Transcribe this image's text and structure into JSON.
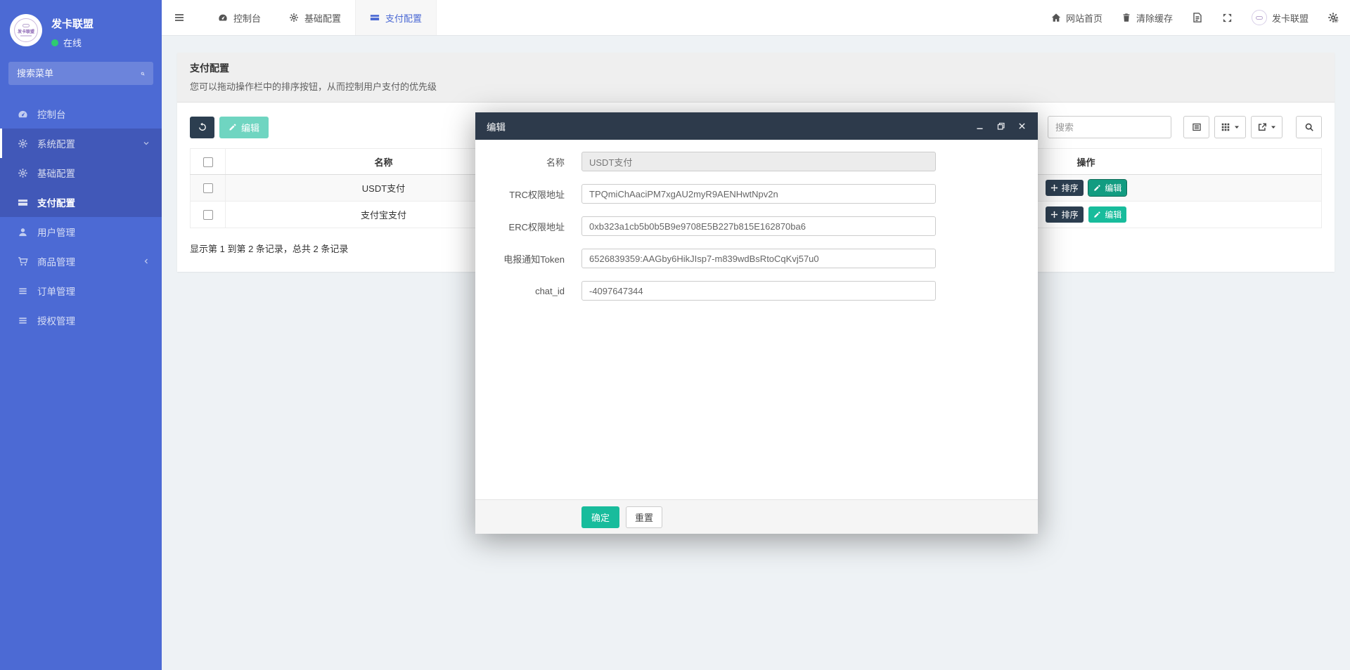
{
  "colors": {
    "sidebar_bg": "#4c6ad4",
    "sidebar_open_bg": "#4158b8",
    "accent_teal": "#18bc9c",
    "dark_button": "#2c3e50",
    "modal_header_bg": "#2d3a4b",
    "online_dot": "#2ecc71",
    "active_tab_text": "#4c6ad4",
    "page_bg": "#eef2f5"
  },
  "sidebar": {
    "brand": {
      "logo_text": "发卡联盟",
      "title": "发卡联盟",
      "status": "在线"
    },
    "search_placeholder": "搜索菜单",
    "items": [
      {
        "label": "控制台",
        "icon": "gauge-icon"
      },
      {
        "label": "系统配置",
        "icon": "gear-icon"
      },
      {
        "label": "基础配置",
        "icon": "gear-icon"
      },
      {
        "label": "支付配置",
        "icon": "card-icon"
      },
      {
        "label": "用户管理",
        "icon": "user-icon"
      },
      {
        "label": "商品管理",
        "icon": "cart-icon"
      },
      {
        "label": "订单管理",
        "icon": "list-icon"
      },
      {
        "label": "授权管理",
        "icon": "list-icon"
      }
    ]
  },
  "navbar": {
    "tabs": [
      {
        "label": "控制台"
      },
      {
        "label": "基础配置"
      },
      {
        "label": "支付配置"
      }
    ],
    "right": {
      "home": "网站首页",
      "clear_cache": "清除缓存",
      "username": "发卡联盟"
    }
  },
  "panel": {
    "title": "支付配置",
    "subtitle": "您可以拖动操作栏中的排序按钮，从而控制用户支付的优先级",
    "toolbar": {
      "edit_label": "编辑",
      "search_placeholder": "搜索"
    },
    "table": {
      "columns": {
        "name": "名称",
        "operate": "操作"
      },
      "rows": [
        {
          "name": "USDT支付",
          "sort_label": "排序",
          "edit_label": "编辑"
        },
        {
          "name": "支付宝支付",
          "sort_label": "排序",
          "edit_label": "编辑"
        }
      ],
      "summary": "显示第 1 到第 2 条记录，总共 2 条记录"
    }
  },
  "modal": {
    "title": "编辑",
    "fields": [
      {
        "label": "名称",
        "value": "USDT支付"
      },
      {
        "label": "TRC权限地址",
        "value": "TPQmiChAaciPM7xgAU2myR9AENHwtNpv2n"
      },
      {
        "label": "ERC权限地址",
        "value": "0xb323a1cb5b0b5B9e9708E5B227b815E162870ba6"
      },
      {
        "label": "电报通知Token",
        "value": "6526839359:AAGby6HikJIsp7-m839wdBsRtoCqKvj57u0"
      },
      {
        "label": "chat_id",
        "value": "-4097647344"
      }
    ],
    "ok_label": "确定",
    "reset_label": "重置"
  }
}
